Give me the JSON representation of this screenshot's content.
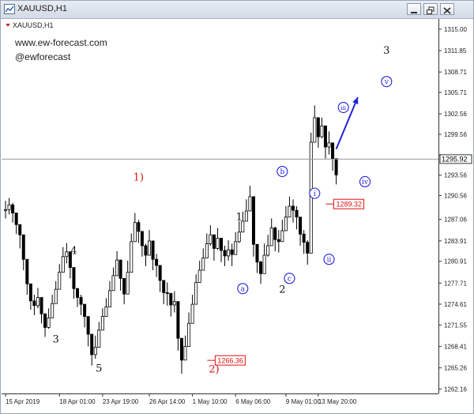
{
  "window": {
    "title": "XAUUSD,H1",
    "symbol_label": "XAUUSD,H1",
    "buttons": [
      "minimize",
      "restore",
      "close"
    ]
  },
  "watermark": {
    "site": "www.ew-forecast.com",
    "handle": "@ewforecast"
  },
  "colors": {
    "candles": "#000000",
    "grid": "#cfcfcf",
    "wave_red": "#e01010",
    "wave_blue": "#2222dd",
    "current_price_line": "#9a9a9a",
    "price_box_red": "#e01010"
  },
  "chart_data": {
    "type": "candlestick",
    "title": "XAUUSD,H1",
    "timeframe": "H1",
    "y_ticks": [
      1315.0,
      1311.85,
      1308.71,
      1305.71,
      1302.56,
      1299.56,
      1296.56,
      1293.56,
      1290.56,
      1287.06,
      1283.91,
      1280.91,
      1277.71,
      1274.61,
      1271.55,
      1268.41,
      1265.26,
      1262.16
    ],
    "y_tick_labels": [
      "1315.00",
      "1311.85",
      "1308.71",
      "1305.71",
      "1302.56",
      "1299.56",
      "",
      "1293.56",
      "1290.56",
      "1287.06",
      "1283.91",
      "1280.91",
      "1277.71",
      "1274.61",
      "1271.55",
      "1268.41",
      "1265.26",
      "1262.16"
    ],
    "ylim": [
      1261.5,
      1316.5
    ],
    "x_labels": [
      "15 Apr 2019",
      "18 Apr 01:00",
      "23 Apr 19:00",
      "26 Apr 14:00",
      "1 May 10:00",
      "6 May 06:00",
      "9 May 01:00",
      "13 May 20:00"
    ],
    "current_price": "1295.92",
    "current_price_value": 1295.92,
    "price_labels": [
      {
        "text": "1289.32",
        "value": 1289.32
      },
      {
        "text": "1266.36",
        "value": 1266.36
      }
    ],
    "series": [
      {
        "close": [
          1288.5,
          1289.2,
          1288.0,
          1286.3,
          1284.8,
          1281.2,
          1277.6,
          1275.1,
          1274.4,
          1275.6,
          1273.2,
          1271.2,
          1272.6,
          1274.7,
          1276.8,
          1279.3,
          1281.6,
          1282.3,
          1280.0,
          1276.9,
          1275.6,
          1274.6,
          1272.8,
          1270.2,
          1267.2,
          1268.3,
          1270.8,
          1272.8,
          1274.2,
          1276.6,
          1278.8,
          1281.1,
          1278.4,
          1276.1,
          1279.3,
          1283.8,
          1286.6,
          1285.3,
          1283.2,
          1281.8,
          1283.9,
          1281.2,
          1280.3,
          1278.1,
          1276.3,
          1276.2,
          1274.5,
          1275.0,
          1269.6,
          1266.4,
          1268.4,
          1271.8,
          1274.6,
          1277.8,
          1279.6,
          1281.4,
          1283.5,
          1284.8,
          1282.8,
          1284.3,
          1282.5,
          1281.7,
          1282.6,
          1281.9,
          1283.8,
          1285.2,
          1286.8,
          1288.3,
          1290.4,
          1283.4,
          1280.8,
          1279.1,
          1281.8,
          1283.2,
          1285.8,
          1284.1,
          1283.8,
          1285.4,
          1287.4,
          1289.0,
          1288.4,
          1287.4,
          1284.9,
          1283.7,
          1282.1,
          1298.4,
          1302.0,
          1299.2,
          1300.8,
          1297.7,
          1298.3,
          1296.0,
          1293.6
        ],
        "high": [
          1289.8,
          1290.2,
          1289.5,
          1287.6,
          1286.0,
          1283.0,
          1279.0,
          1276.5,
          1276.0,
          1277.0,
          1275.0,
          1272.5,
          1274.0,
          1276.0,
          1278.0,
          1280.5,
          1283.0,
          1283.6,
          1282.0,
          1278.5,
          1277.0,
          1276.0,
          1274.5,
          1271.5,
          1269.0,
          1270.0,
          1272.0,
          1274.0,
          1275.5,
          1278.0,
          1280.0,
          1282.4,
          1280.2,
          1278.0,
          1281.0,
          1285.0,
          1288.0,
          1287.0,
          1285.0,
          1283.5,
          1285.5,
          1283.0,
          1282.0,
          1280.0,
          1278.0,
          1277.8,
          1276.2,
          1276.5,
          1271.5,
          1268.0,
          1270.0,
          1273.4,
          1276.0,
          1279.0,
          1281.0,
          1282.8,
          1285.0,
          1286.2,
          1284.5,
          1285.8,
          1284.0,
          1283.2,
          1284.0,
          1283.5,
          1285.2,
          1286.8,
          1288.2,
          1290.0,
          1292.0,
          1285.5,
          1282.5,
          1281.0,
          1283.5,
          1284.8,
          1287.2,
          1286.0,
          1285.5,
          1287.0,
          1289.0,
          1290.4,
          1290.0,
          1289.0,
          1286.5,
          1285.5,
          1284.0,
          1299.8,
          1303.8,
          1301.0,
          1302.0,
          1299.5,
          1300.0,
          1297.8,
          1296.0
        ],
        "low": [
          1287.2,
          1287.8,
          1286.6,
          1284.9,
          1282.8,
          1279.6,
          1276.0,
          1273.8,
          1273.0,
          1274.0,
          1271.8,
          1269.8,
          1271.0,
          1273.2,
          1275.4,
          1277.8,
          1280.2,
          1280.6,
          1278.4,
          1275.4,
          1274.2,
          1273.0,
          1271.2,
          1268.4,
          1265.6,
          1266.6,
          1269.2,
          1271.2,
          1272.8,
          1275.0,
          1277.2,
          1279.6,
          1276.6,
          1274.6,
          1277.8,
          1282.2,
          1285.0,
          1283.6,
          1281.6,
          1280.2,
          1282.2,
          1279.6,
          1278.6,
          1276.4,
          1274.6,
          1274.4,
          1272.8,
          1273.4,
          1267.8,
          1264.4,
          1266.6,
          1270.2,
          1273.0,
          1276.2,
          1278.0,
          1279.8,
          1282.0,
          1283.2,
          1281.0,
          1282.6,
          1280.8,
          1280.2,
          1281.0,
          1280.2,
          1282.2,
          1283.6,
          1285.2,
          1286.8,
          1288.6,
          1281.6,
          1279.2,
          1277.6,
          1280.2,
          1281.6,
          1284.2,
          1282.4,
          1282.2,
          1283.8,
          1285.8,
          1287.4,
          1286.6,
          1285.6,
          1283.2,
          1282.0,
          1280.4,
          1296.6,
          1300.2,
          1297.6,
          1299.0,
          1296.0,
          1296.6,
          1294.2,
          1292.2
        ]
      }
    ],
    "blue_arrow": {
      "from": {
        "i": 92,
        "value": 1297.4
      },
      "to": {
        "i": 98,
        "value": 1305.0
      }
    }
  },
  "wave_labels": [
    {
      "text": "1)",
      "kind": "red",
      "i": 37,
      "value": 1292.8
    },
    {
      "text": "2)",
      "kind": "red",
      "i": 58,
      "value": 1264.6
    },
    {
      "text": "3",
      "kind": "black",
      "i": 14,
      "value": 1269.0
    },
    {
      "text": "4",
      "kind": "black",
      "i": 19,
      "value": 1282.0
    },
    {
      "text": "5",
      "kind": "black",
      "i": 26,
      "value": 1264.7
    },
    {
      "text": "1",
      "kind": "black",
      "i": 65,
      "value": 1286.9
    },
    {
      "text": "2",
      "kind": "black",
      "i": 77,
      "value": 1276.3
    },
    {
      "text": "3",
      "kind": "black",
      "i": 106,
      "value": 1311.4
    },
    {
      "text": "a",
      "kind": "blue-circle",
      "i": 66,
      "value": 1276.9
    },
    {
      "text": "b",
      "kind": "blue-circle",
      "i": 77,
      "value": 1294.1
    },
    {
      "text": "c",
      "kind": "blue-circle",
      "i": 79,
      "value": 1278.4
    },
    {
      "text": "i",
      "kind": "blue-circle",
      "i": 86,
      "value": 1290.9
    },
    {
      "text": "ii",
      "kind": "blue-circle",
      "i": 90,
      "value": 1281.2
    },
    {
      "text": "iii",
      "kind": "blue-circle",
      "i": 94,
      "value": 1303.5
    },
    {
      "text": "iv",
      "kind": "blue-circle",
      "i": 100,
      "value": 1292.6
    },
    {
      "text": "v",
      "kind": "blue-circle",
      "i": 106,
      "value": 1307.3
    }
  ]
}
